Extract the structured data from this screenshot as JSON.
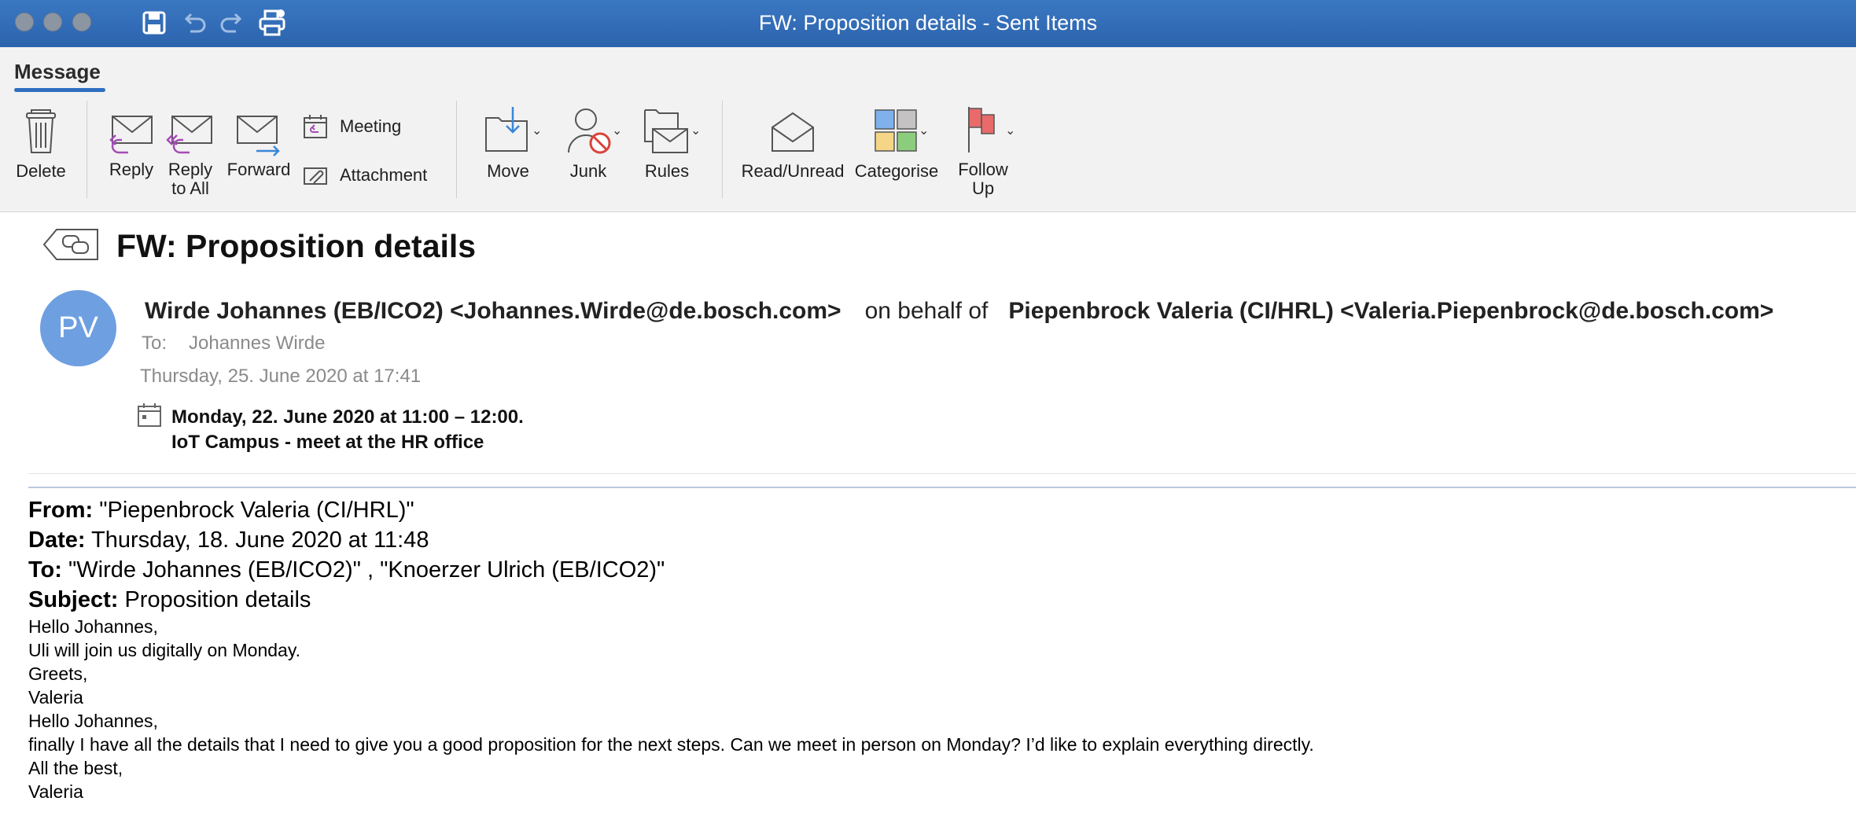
{
  "window": {
    "title": "FW: Proposition details - Sent Items"
  },
  "ribbon": {
    "tab": "Message",
    "delete": "Delete",
    "reply": "Reply",
    "reply_all": "Reply\nto All",
    "reply_all_1": "Reply",
    "reply_all_2": "to All",
    "forward": "Forward",
    "meeting": "Meeting",
    "attachment": "Attachment",
    "move": "Move",
    "junk": "Junk",
    "rules": "Rules",
    "read_unread": "Read/Unread",
    "categorise": "Categorise",
    "follow_up_1": "Follow",
    "follow_up_2": "Up"
  },
  "message": {
    "subject": "FW: Proposition details",
    "avatar_initials": "PV",
    "sender": "Wirde Johannes (EB/ICO2) <Johannes.Wirde@de.bosch.com>",
    "on_behalf_of": "on behalf of",
    "behalf_sender": "Piepenbrock Valeria (CI/HRL) <Valeria.Piepenbrock@de.bosch.com>",
    "to_label": "To:",
    "to_value": "Johannes Wirde",
    "sent_date": "Thursday, 25. June 2020 at 17:41",
    "meeting_time": "Monday, 22. June 2020 at 11:00 – 12:00.",
    "meeting_location": "IoT Campus - meet at the HR office"
  },
  "forwarded": {
    "from_label": "From:",
    "from_value": " \"Piepenbrock Valeria (CI/HRL)\"",
    "date_label": "Date:",
    "date_value": " Thursday, 18. June 2020 at 11:48",
    "to_label": "To:",
    "to_value": " \"Wirde Johannes (EB/ICO2)\" , \"Knoerzer Ulrich (EB/ICO2)\"",
    "subject_label": "Subject:",
    "subject_value": " Proposition details",
    "lines": [
      "Hello Johannes,",
      "Uli will join us digitally on Monday.",
      "Greets,",
      "Valeria",
      "Hello Johannes,",
      "finally I have all the details that I need to give you a good proposition for the next steps. Can we meet in person on Monday? I’d like to explain everything directly.",
      "All the best,",
      "Valeria"
    ]
  },
  "colors": {
    "titlebar": "#2f6ab3",
    "accent": "#2f6fc0",
    "avatar": "#6e9fe0",
    "flag": "#e86a6a"
  },
  "icons": [
    "save-icon",
    "undo-icon",
    "redo-icon",
    "print-icon",
    "trash-icon",
    "reply-icon",
    "reply-all-icon",
    "forward-icon",
    "calendar-icon",
    "paperclip-icon",
    "move-folder-icon",
    "junk-icon",
    "rules-icon",
    "envelope-open-icon",
    "categories-icon",
    "flag-icon",
    "conversation-back-icon"
  ]
}
